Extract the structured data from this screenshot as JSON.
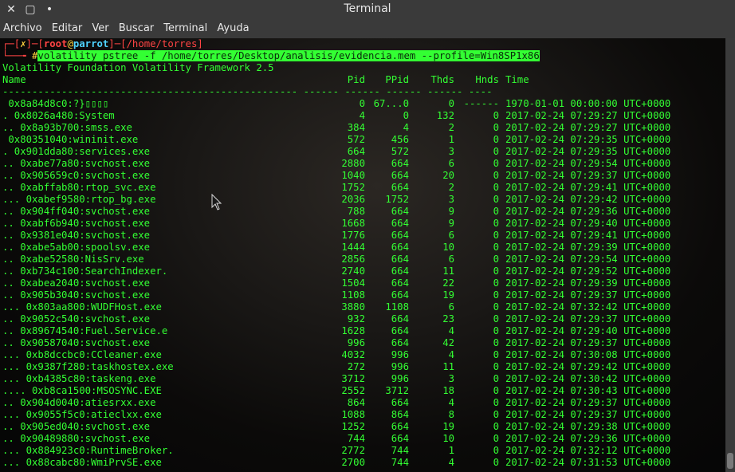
{
  "window": {
    "title": "Terminal",
    "close_glyph": "✕",
    "maximize_glyph": "▢",
    "minimize_glyph": "•"
  },
  "menu": [
    "Archivo",
    "Editar",
    "Ver",
    "Buscar",
    "Terminal",
    "Ayuda"
  ],
  "prompt": {
    "line1_prefix": "┌─[",
    "x": "✗",
    "sep1": "]─[",
    "user": "root",
    "at": "@",
    "host": "parrot",
    "sep2": "]─[",
    "dir": "/home/torres",
    "close": "]",
    "line2_prefix": "└──╼ ",
    "hash": "#",
    "command": "volatility pstree -f /home/torres/Desktop/analisis/evidencia.mem --profile=Win8SP1x86"
  },
  "banner": "Volatility Foundation Volatility Framework 2.5",
  "headers": {
    "name": "Name",
    "pid": "Pid",
    "ppid": "PPid",
    "thds": "Thds",
    "hnds": "Hnds",
    "time": "Time"
  },
  "separator": "-------------------------------------------------- ------ ------ ------ ------ ----",
  "rows": [
    {
      "name": " 0x8a84d8c0:?}▯▯▯▯",
      "pid": "0",
      "ppid": "67...0",
      "thds": "0",
      "hnds": "------",
      "time": "1970-01-01 00:00:00 UTC+0000"
    },
    {
      "name": ". 0x8026a480:System",
      "pid": "4",
      "ppid": "0",
      "thds": "132",
      "hnds": "0",
      "time": "2017-02-24 07:29:27 UTC+0000"
    },
    {
      "name": ".. 0x8a93b700:smss.exe",
      "pid": "384",
      "ppid": "4",
      "thds": "2",
      "hnds": "0",
      "time": "2017-02-24 07:29:27 UTC+0000"
    },
    {
      "name": " 0x80351040:wininit.exe",
      "pid": "572",
      "ppid": "456",
      "thds": "1",
      "hnds": "0",
      "time": "2017-02-24 07:29:35 UTC+0000"
    },
    {
      "name": ". 0x901dda80:services.exe",
      "pid": "664",
      "ppid": "572",
      "thds": "3",
      "hnds": "0",
      "time": "2017-02-24 07:29:35 UTC+0000"
    },
    {
      "name": ".. 0xabe77a80:svchost.exe",
      "pid": "2880",
      "ppid": "664",
      "thds": "6",
      "hnds": "0",
      "time": "2017-02-24 07:29:54 UTC+0000"
    },
    {
      "name": ".. 0x905659c0:svchost.exe",
      "pid": "1040",
      "ppid": "664",
      "thds": "20",
      "hnds": "0",
      "time": "2017-02-24 07:29:37 UTC+0000"
    },
    {
      "name": ".. 0xabffab80:rtop_svc.exe",
      "pid": "1752",
      "ppid": "664",
      "thds": "2",
      "hnds": "0",
      "time": "2017-02-24 07:29:41 UTC+0000"
    },
    {
      "name": "... 0xabef9580:rtop_bg.exe",
      "pid": "2036",
      "ppid": "1752",
      "thds": "3",
      "hnds": "0",
      "time": "2017-02-24 07:29:42 UTC+0000"
    },
    {
      "name": ".. 0x904ff040:svchost.exe",
      "pid": "788",
      "ppid": "664",
      "thds": "9",
      "hnds": "0",
      "time": "2017-02-24 07:29:36 UTC+0000"
    },
    {
      "name": ".. 0xabf6b940:svchost.exe",
      "pid": "1668",
      "ppid": "664",
      "thds": "9",
      "hnds": "0",
      "time": "2017-02-24 07:29:40 UTC+0000"
    },
    {
      "name": ".. 0x9381e040:svchost.exe",
      "pid": "1776",
      "ppid": "664",
      "thds": "6",
      "hnds": "0",
      "time": "2017-02-24 07:29:41 UTC+0000"
    },
    {
      "name": ".. 0xabe5ab00:spoolsv.exe",
      "pid": "1444",
      "ppid": "664",
      "thds": "10",
      "hnds": "0",
      "time": "2017-02-24 07:29:39 UTC+0000"
    },
    {
      "name": ".. 0xabe52580:NisSrv.exe",
      "pid": "2856",
      "ppid": "664",
      "thds": "6",
      "hnds": "0",
      "time": "2017-02-24 07:29:54 UTC+0000"
    },
    {
      "name": ".. 0xb734c100:SearchIndexer.",
      "pid": "2740",
      "ppid": "664",
      "thds": "11",
      "hnds": "0",
      "time": "2017-02-24 07:29:52 UTC+0000"
    },
    {
      "name": ".. 0xabea2040:svchost.exe",
      "pid": "1504",
      "ppid": "664",
      "thds": "22",
      "hnds": "0",
      "time": "2017-02-24 07:29:39 UTC+0000"
    },
    {
      "name": ".. 0x905b3040:svchost.exe",
      "pid": "1108",
      "ppid": "664",
      "thds": "19",
      "hnds": "0",
      "time": "2017-02-24 07:29:37 UTC+0000"
    },
    {
      "name": "... 0x803aa800:WUDFHost.exe",
      "pid": "3880",
      "ppid": "1108",
      "thds": "6",
      "hnds": "0",
      "time": "2017-02-24 07:32:42 UTC+0000"
    },
    {
      "name": ".. 0x9052c540:svchost.exe",
      "pid": "932",
      "ppid": "664",
      "thds": "23",
      "hnds": "0",
      "time": "2017-02-24 07:29:37 UTC+0000"
    },
    {
      "name": ".. 0x89674540:Fuel.Service.e",
      "pid": "1628",
      "ppid": "664",
      "thds": "4",
      "hnds": "0",
      "time": "2017-02-24 07:29:40 UTC+0000"
    },
    {
      "name": ".. 0x90587040:svchost.exe",
      "pid": "996",
      "ppid": "664",
      "thds": "42",
      "hnds": "0",
      "time": "2017-02-24 07:29:37 UTC+0000"
    },
    {
      "name": "... 0xb8dccbc0:CCleaner.exe",
      "pid": "4032",
      "ppid": "996",
      "thds": "4",
      "hnds": "0",
      "time": "2017-02-24 07:30:08 UTC+0000"
    },
    {
      "name": "... 0x9387f280:taskhostex.exe",
      "pid": "272",
      "ppid": "996",
      "thds": "11",
      "hnds": "0",
      "time": "2017-02-24 07:29:42 UTC+0000"
    },
    {
      "name": "... 0xb4385c80:taskeng.exe",
      "pid": "3712",
      "ppid": "996",
      "thds": "3",
      "hnds": "0",
      "time": "2017-02-24 07:30:42 UTC+0000"
    },
    {
      "name": ".... 0xb8ca1500:MSOSYNC.EXE",
      "pid": "2552",
      "ppid": "3712",
      "thds": "18",
      "hnds": "0",
      "time": "2017-02-24 07:30:43 UTC+0000"
    },
    {
      "name": ".. 0x904d0040:atiesrxx.exe",
      "pid": "864",
      "ppid": "664",
      "thds": "4",
      "hnds": "0",
      "time": "2017-02-24 07:29:37 UTC+0000"
    },
    {
      "name": "... 0x9055f5c0:atieclxx.exe",
      "pid": "1088",
      "ppid": "864",
      "thds": "8",
      "hnds": "0",
      "time": "2017-02-24 07:29:37 UTC+0000"
    },
    {
      "name": ".. 0x905ed040:svchost.exe",
      "pid": "1252",
      "ppid": "664",
      "thds": "19",
      "hnds": "0",
      "time": "2017-02-24 07:29:38 UTC+0000"
    },
    {
      "name": ".. 0x90489880:svchost.exe",
      "pid": "744",
      "ppid": "664",
      "thds": "10",
      "hnds": "0",
      "time": "2017-02-24 07:29:36 UTC+0000"
    },
    {
      "name": "... 0x884923c0:RuntimeBroker.",
      "pid": "2772",
      "ppid": "744",
      "thds": "1",
      "hnds": "0",
      "time": "2017-02-24 07:32:12 UTC+0000"
    },
    {
      "name": "... 0x88cabc80:WmiPrvSE.exe",
      "pid": "2700",
      "ppid": "744",
      "thds": "4",
      "hnds": "0",
      "time": "2017-02-24 07:31:53 UTC+0000"
    }
  ]
}
